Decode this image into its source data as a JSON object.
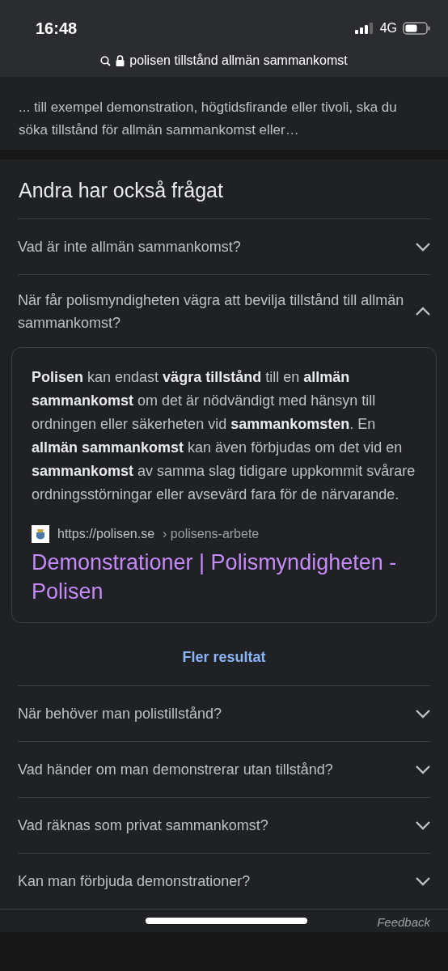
{
  "status_bar": {
    "time": "16:48",
    "network": "4G"
  },
  "address_bar": {
    "query": "polisen tillstånd allmän sammankomst"
  },
  "previous_result": {
    "snippet": "... till exempel demonstration, högtidsfirande eller tivoli, ska du söka tillstånd för allmän sammankomst eller…"
  },
  "people_also_ask": {
    "heading": "Andra har också frågat",
    "questions": [
      {
        "text": "Vad är inte allmän sammankomst?",
        "expanded": false
      },
      {
        "text": "När får polismyndigheten vägra att bevilja tillstånd till allmän sammankomst?",
        "expanded": true,
        "answer": {
          "text": "**Polisen** kan endast **vägra tillstånd** till en **allmän sammankomst** om det är nödvändigt med hänsyn till ordningen eller säkerheten vid **sammankomsten**. En **allmän sammankomst** kan även förbjudas om det vid en **sammankomst** av samma slag tidigare uppkommit svårare ordningsstörningar eller avsevärd fara för de närvarande.",
          "source_url": "https://polisen.se",
          "source_path": "› polisens-arbete",
          "title": "Demonstrationer | Polismyndigheten - Polisen"
        }
      }
    ],
    "more": "Fler resultat",
    "more_questions": [
      {
        "text": "När behöver man polistillstånd?",
        "expanded": false
      },
      {
        "text": "Vad händer om man demonstrerar utan tillstånd?",
        "expanded": false
      },
      {
        "text": "Vad räknas som privat sammankomst?",
        "expanded": false
      },
      {
        "text": "Kan man förbjuda demonstrationer?",
        "expanded": false
      }
    ]
  },
  "footer": {
    "feedback": "Feedback"
  }
}
